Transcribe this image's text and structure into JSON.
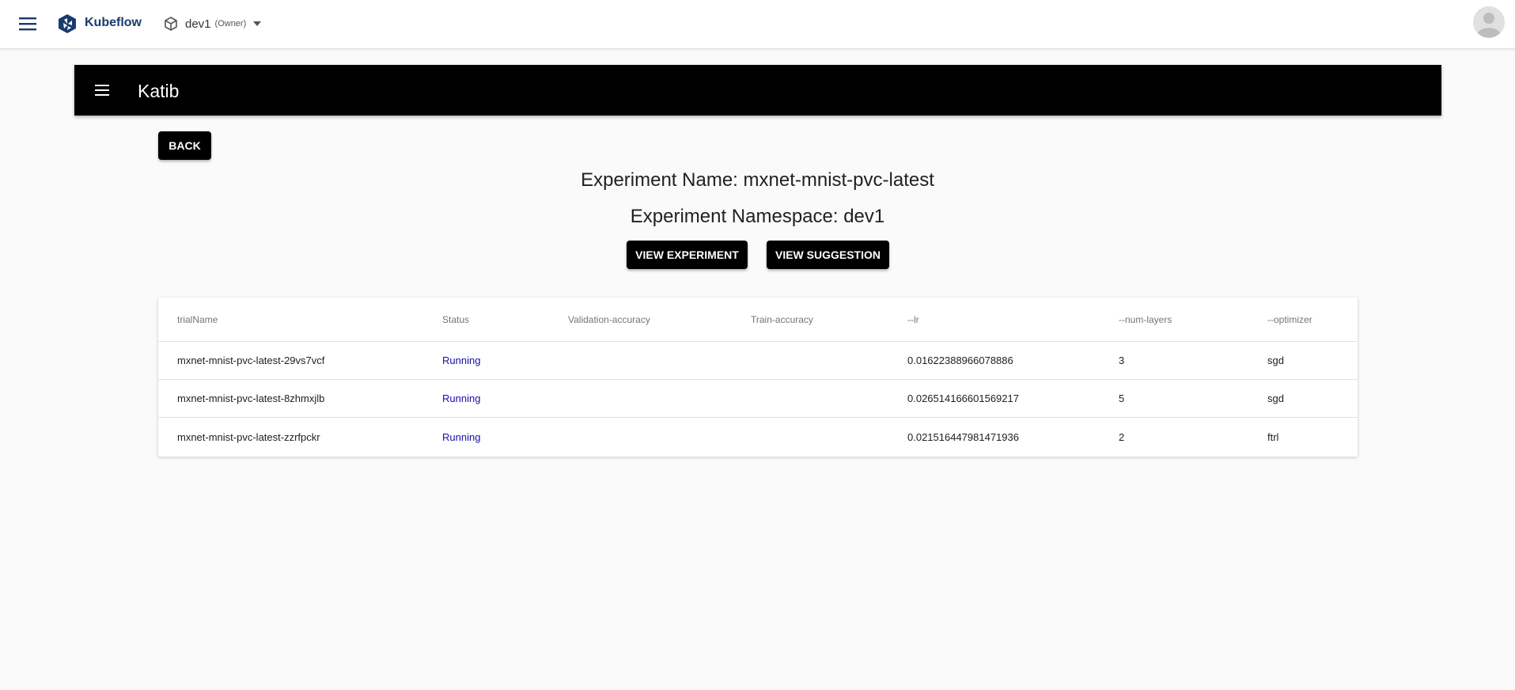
{
  "topbar": {
    "brand": "Kubeflow",
    "namespace": "dev1",
    "namespace_role": "(Owner)"
  },
  "katib": {
    "title": "Katib"
  },
  "actions": {
    "back_label": "BACK",
    "view_experiment_label": "VIEW EXPERIMENT",
    "view_suggestion_label": "VIEW SUGGESTION"
  },
  "experiment": {
    "name_line": "Experiment Name: mxnet-mnist-pvc-latest",
    "namespace_line": "Experiment Namespace: dev1"
  },
  "table": {
    "columns": [
      "trialName",
      "Status",
      "Validation-accuracy",
      "Train-accuracy",
      "--lr",
      "--num-layers",
      "--optimizer"
    ],
    "rows": [
      [
        "mxnet-mnist-pvc-latest-29vs7vcf",
        "Running",
        "",
        "",
        "0.01622388966078886",
        "3",
        "sgd"
      ],
      [
        "mxnet-mnist-pvc-latest-8zhmxjlb",
        "Running",
        "",
        "",
        "0.026514166601569217",
        "5",
        "sgd"
      ],
      [
        "mxnet-mnist-pvc-latest-zzrfpckr",
        "Running",
        "",
        "",
        "0.021516447981471936",
        "2",
        "ftrl"
      ]
    ]
  },
  "colors": {
    "brand": "#1a3b6e",
    "katib_bar": "#000000",
    "status_link": "#1a0dab",
    "background": "#fafafa"
  },
  "icons": {
    "menu": "menu-icon",
    "logo": "kubeflow-logo-icon",
    "namespace": "cube-icon",
    "dropdown": "caret-down-icon",
    "avatar": "account-circle-icon"
  }
}
